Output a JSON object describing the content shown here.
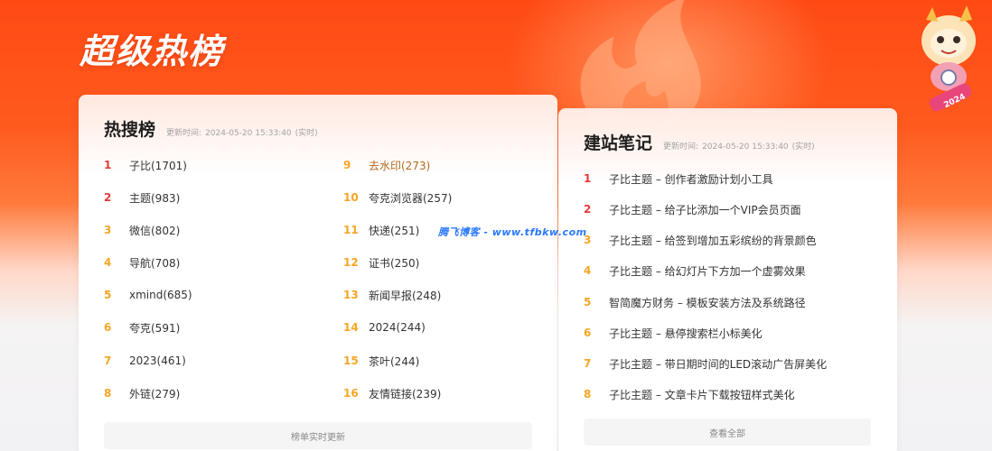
{
  "page": {
    "title": "超级热榜"
  },
  "hot_search": {
    "title": "热搜榜",
    "updated_label": "更新时间:",
    "updated_time": "2024-05-20 15:33:40",
    "realtime": "(实时)",
    "items": [
      {
        "rank": "1",
        "text": "子比(1701)"
      },
      {
        "rank": "2",
        "text": "主题(983)"
      },
      {
        "rank": "3",
        "text": "微信(802)"
      },
      {
        "rank": "4",
        "text": "导航(708)"
      },
      {
        "rank": "5",
        "text": "xmind(685)"
      },
      {
        "rank": "6",
        "text": "夸克(591)"
      },
      {
        "rank": "7",
        "text": "2023(461)"
      },
      {
        "rank": "8",
        "text": "外链(279)"
      },
      {
        "rank": "9",
        "text": "去水印(273)"
      },
      {
        "rank": "10",
        "text": "夸克浏览器(257)"
      },
      {
        "rank": "11",
        "text": "快递(251)"
      },
      {
        "rank": "12",
        "text": "证书(250)"
      },
      {
        "rank": "13",
        "text": "新闻早报(248)"
      },
      {
        "rank": "14",
        "text": "2024(244)"
      },
      {
        "rank": "15",
        "text": "茶叶(244)"
      },
      {
        "rank": "16",
        "text": "友情链接(239)"
      }
    ],
    "footer_button": "榜单实时更新"
  },
  "notes": {
    "title": "建站笔记",
    "updated_label": "更新时间:",
    "updated_time": "2024-05-20 15:33:40",
    "realtime": "(实时)",
    "items": [
      {
        "rank": "1",
        "text": "子比主题 – 创作者激励计划小工具"
      },
      {
        "rank": "2",
        "text": "子比主题 – 给子比添加一个VIP会员页面"
      },
      {
        "rank": "3",
        "text": "子比主题 – 给签到增加五彩缤纷的背景颜色"
      },
      {
        "rank": "4",
        "text": "子比主题 – 给幻灯片下方加一个虚雾效果"
      },
      {
        "rank": "5",
        "text": "智简魔方财务 – 模板安装方法及系统路径"
      },
      {
        "rank": "6",
        "text": "子比主题 – 悬停搜索栏小标美化"
      },
      {
        "rank": "7",
        "text": "子比主题 – 带日期时间的LED滚动广告屏美化"
      },
      {
        "rank": "8",
        "text": "子比主题 – 文章卡片下载按钮样式美化"
      }
    ],
    "footer_button": "查看全部"
  },
  "watermark": "腾飞博客 - www.tfbkw.com",
  "colors": {
    "rank_top": "#e53935",
    "rank_other": "#f5a623",
    "accent": "#ff4a14"
  }
}
